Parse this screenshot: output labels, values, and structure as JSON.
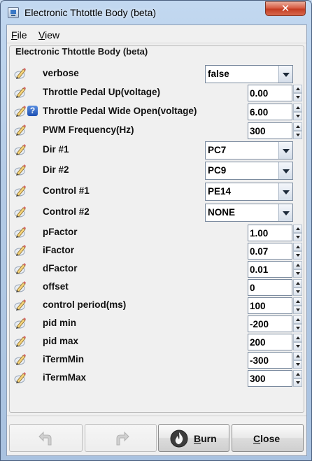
{
  "window": {
    "title": "Electronic Thtottle Body (beta)",
    "close_glyph": "✕"
  },
  "menu": {
    "file": {
      "mnemonic": "F",
      "rest": "ile"
    },
    "view": {
      "mnemonic": "V",
      "rest": "iew"
    }
  },
  "panel": {
    "title": "Electronic Thtottle Body (beta)",
    "rows": [
      {
        "label": "verbose",
        "kind": "combo",
        "value": "false",
        "help": false
      },
      {
        "label": "Throttle Pedal Up(voltage)",
        "kind": "spin",
        "value": "0.00",
        "help": false
      },
      {
        "label": "Throttle Pedal Wide Open(voltage)",
        "kind": "spin",
        "value": "6.00",
        "help": true
      },
      {
        "label": "PWM Frequency(Hz)",
        "kind": "spin",
        "value": "300",
        "help": false
      },
      {
        "label": "Dir #1",
        "kind": "combo",
        "value": "PC7",
        "help": false
      },
      {
        "label": "Dir #2",
        "kind": "combo",
        "value": "PC9",
        "help": false
      },
      {
        "label": "Control #1",
        "kind": "combo",
        "value": "PE14",
        "help": false
      },
      {
        "label": "Control #2",
        "kind": "combo",
        "value": "NONE",
        "help": false
      },
      {
        "label": "pFactor",
        "kind": "spin",
        "value": "1.00",
        "help": false
      },
      {
        "label": "iFactor",
        "kind": "spin",
        "value": "0.07",
        "help": false
      },
      {
        "label": "dFactor",
        "kind": "spin",
        "value": "0.01",
        "help": false
      },
      {
        "label": "offset",
        "kind": "spin",
        "value": "0",
        "help": false
      },
      {
        "label": "control period(ms)",
        "kind": "spin",
        "value": "100",
        "help": false
      },
      {
        "label": "pid min",
        "kind": "spin",
        "value": "-200",
        "help": false
      },
      {
        "label": "pid max",
        "kind": "spin",
        "value": "200",
        "help": false
      },
      {
        "label": "iTermMin",
        "kind": "spin",
        "value": "-300",
        "help": false
      },
      {
        "label": "iTermMax",
        "kind": "spin",
        "value": "300",
        "help": false
      }
    ]
  },
  "buttons": {
    "undo_icon": "undo-arrow-icon",
    "redo_icon": "redo-arrow-icon",
    "burn": {
      "mnemonic": "B",
      "rest": "urn"
    },
    "close": {
      "mnemonic": "C",
      "rest": "lose"
    }
  },
  "colors": {
    "titlebar": "#b4cbe6",
    "close_button": "#c23a20",
    "help_badge": "#1d4fb2",
    "burn_flame": "#e8421f"
  }
}
